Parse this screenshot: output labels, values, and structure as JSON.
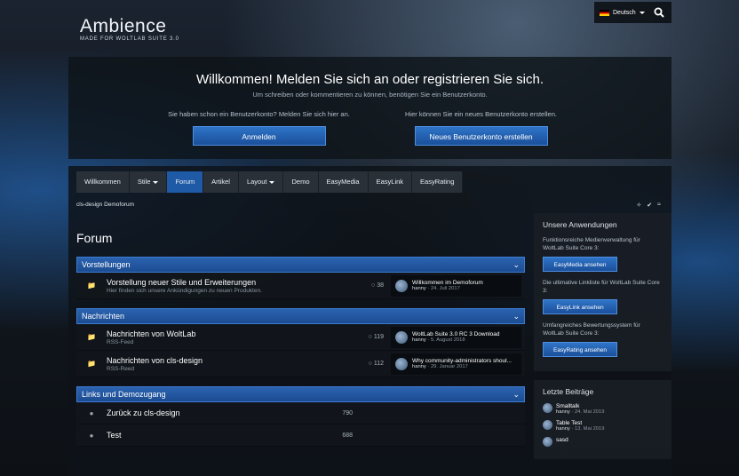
{
  "header": {
    "logo_title": "Ambience",
    "logo_subtitle": "MADE FOR WOLTLAB SUITE 3.0",
    "language": "Deutsch"
  },
  "welcome": {
    "title": "Willkommen! Melden Sie sich an oder registrieren Sie sich.",
    "subtitle": "Um schreiben oder kommentieren zu können, benötigen Sie ein Benutzerkonto.",
    "left_text": "Sie haben schon ein Benutzerkonto? Melden Sie sich hier an.",
    "right_text": "Hier können Sie ein neues Benutzerkonto erstellen.",
    "login_button": "Anmelden",
    "register_button": "Neues Benutzerkonto erstellen"
  },
  "nav": [
    "Willkommen",
    "Stile",
    "Forum",
    "Artikel",
    "Layout",
    "Demo",
    "EasyMedia",
    "EasyLink",
    "EasyRating"
  ],
  "breadcrumb": "cls-design Demoforum",
  "page_title": "Forum",
  "categories": [
    {
      "name": "Vorstellungen",
      "boards": [
        {
          "name": "Vorstellung neuer Stile und Erweiterungen",
          "desc": "Hier finden sich unsere Ankündigungen zu neuen Produkten.",
          "count": "38",
          "last_title": "Willkommen im Demoforum",
          "last_user": "hanny",
          "last_date": "24. Juli 2017"
        }
      ]
    },
    {
      "name": "Nachrichten",
      "boards": [
        {
          "name": "Nachrichten von WoltLab",
          "desc": "RSS-Feed",
          "count": "119",
          "last_title": "WoltLab Suite 3.0 RC 3 Download",
          "last_user": "hanny",
          "last_date": "5. August 2018"
        },
        {
          "name": "Nachrichten von cls-design",
          "desc": "RSS-Reed",
          "count": "112",
          "last_title": "Why community-administrators shoul...",
          "last_user": "hanny",
          "last_date": "29. Januar 2017"
        }
      ]
    },
    {
      "name": "Links und Demozugang",
      "boards": [
        {
          "name": "Zurück zu cls-design",
          "desc": "",
          "count": "790"
        },
        {
          "name": "Test",
          "desc": "",
          "count": "688"
        }
      ]
    }
  ],
  "sidebar": {
    "apps_title": "Unsere Anwendungen",
    "apps": [
      {
        "text": "Funktionsreiche Medienverwaltung für WoltLab Suite Core 3:",
        "button": "EasyMedia ansehen"
      },
      {
        "text": "Die ultimative Linkliste für WoltLab Suite Core 3:",
        "button": "EasyLink ansehen"
      },
      {
        "text": "Umfangreiches Bewertungssystem für WoltLab Suite Core 3:",
        "button": "EasyRating ansehen"
      }
    ],
    "posts_title": "Letzte Beiträge",
    "posts": [
      {
        "title": "Smalltalk",
        "user": "hanny",
        "date": "24. Mai 2019"
      },
      {
        "title": "Table Test",
        "user": "hanny",
        "date": "13. Mai 2019"
      },
      {
        "title": "sasd",
        "user": "",
        "date": ""
      }
    ]
  }
}
